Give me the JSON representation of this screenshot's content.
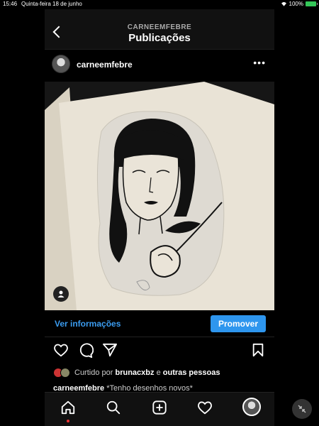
{
  "status": {
    "time": "15:46",
    "date": "Quinta-feira 18 de junho",
    "battery": "100%"
  },
  "header": {
    "username": "CARNEEMFEBRE",
    "title": "Publicações"
  },
  "post": {
    "username": "carneemfebre",
    "more_icon": "ellipsis-icon",
    "ver_informacoes": "Ver informações",
    "promover": "Promover",
    "liked_prefix": "Curtido por",
    "liked_user": "brunacxbz",
    "liked_and": "e",
    "liked_others": "outras pessoas",
    "caption_user": "carneemfebre",
    "caption_text": "*Tenho desenhos novos*"
  },
  "colors": {
    "accent": "#2e96ee",
    "link": "#3b9cf0",
    "background": "#000000"
  },
  "tabbar": {
    "items": [
      "home-icon",
      "search-icon",
      "add-icon",
      "heart-icon",
      "profile-avatar"
    ]
  }
}
